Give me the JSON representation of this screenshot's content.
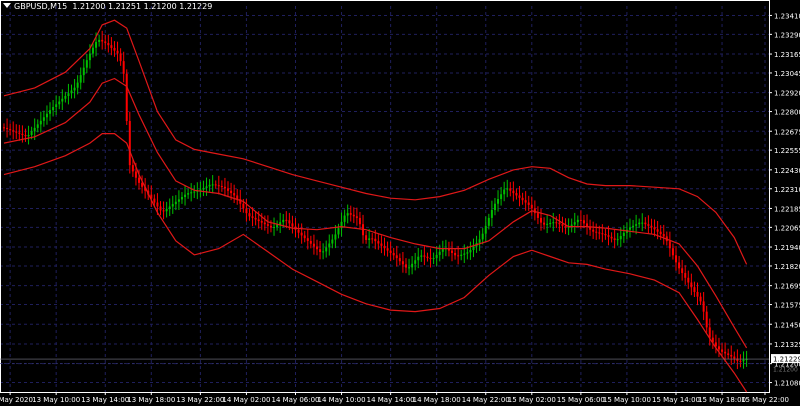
{
  "header": {
    "symbol_label": "GBPUSD,M15",
    "ohlc_label": "1.21200 1.21251 1.21200 1.21229"
  },
  "colors": {
    "background": "#000000",
    "foreground": "#ffffff",
    "grid": "#1f1f5c",
    "bull": "#00c000",
    "bear": "#ff0000",
    "band": "#e01818"
  },
  "chart_data": {
    "type": "line",
    "symbol": "GBPUSD",
    "timeframe": "M15",
    "grid": true,
    "ylim": [
      1.2102,
      1.2347
    ],
    "x_range": [
      0,
      248
    ],
    "x_ticks": [
      {
        "x": 2,
        "label": "13 May 2020"
      },
      {
        "x": 17,
        "label": "13 May 10:00"
      },
      {
        "x": 33,
        "label": "13 May 14:00"
      },
      {
        "x": 48,
        "label": "13 May 18:00"
      },
      {
        "x": 64,
        "label": "13 May 22:00"
      },
      {
        "x": 79,
        "label": "14 May 02:00"
      },
      {
        "x": 95,
        "label": "14 May 06:00"
      },
      {
        "x": 110,
        "label": "14 May 10:00"
      },
      {
        "x": 126,
        "label": "14 May 14:00"
      },
      {
        "x": 141,
        "label": "14 May 18:00"
      },
      {
        "x": 157,
        "label": "14 May 22:00"
      },
      {
        "x": 172,
        "label": "15 May 02:00"
      },
      {
        "x": 188,
        "label": "15 May 06:00"
      },
      {
        "x": 203,
        "label": "15 May 10:00"
      },
      {
        "x": 219,
        "label": "15 May 14:00"
      },
      {
        "x": 234,
        "label": "15 May 18:00"
      },
      {
        "x": 248,
        "label": "15 May 22:00"
      }
    ],
    "y_ticks": [
      "1.23410",
      "1.23290",
      "1.23165",
      "1.23045",
      "1.22920",
      "1.22800",
      "1.22675",
      "1.22555",
      "1.22430",
      "1.22310",
      "1.22185",
      "1.22065",
      "1.21940",
      "1.21820",
      "1.21695",
      "1.21575",
      "1.21450",
      "1.21325",
      "1.21200",
      "1.21080"
    ],
    "current_price": "1.21229",
    "current_price_value": 1.21229,
    "lower_price": "1.21200",
    "lower_price_value": 1.212,
    "series": [
      {
        "role": "price",
        "points": [
          [
            0,
            1.227
          ],
          [
            8,
            1.2264
          ],
          [
            16,
            1.2282
          ],
          [
            24,
            1.2296
          ],
          [
            28,
            1.2315
          ],
          [
            31,
            1.2326
          ],
          [
            34,
            1.2323
          ],
          [
            38,
            1.2316
          ],
          [
            40,
            1.23
          ],
          [
            41,
            1.2248
          ],
          [
            44,
            1.2236
          ],
          [
            48,
            1.2226
          ],
          [
            52,
            1.2216
          ],
          [
            56,
            1.2222
          ],
          [
            60,
            1.2228
          ],
          [
            64,
            1.223
          ],
          [
            68,
            1.2234
          ],
          [
            72,
            1.2232
          ],
          [
            76,
            1.2226
          ],
          [
            80,
            1.2214
          ],
          [
            84,
            1.221
          ],
          [
            88,
            1.2206
          ],
          [
            92,
            1.2212
          ],
          [
            96,
            1.2204
          ],
          [
            100,
            1.2197
          ],
          [
            104,
            1.219
          ],
          [
            108,
            1.22
          ],
          [
            112,
            1.2216
          ],
          [
            116,
            1.2212
          ],
          [
            118,
            1.2198
          ],
          [
            120,
            1.22
          ],
          [
            124,
            1.2194
          ],
          [
            128,
            1.2188
          ],
          [
            132,
            1.218
          ],
          [
            136,
            1.2189
          ],
          [
            140,
            1.2186
          ],
          [
            144,
            1.2194
          ],
          [
            148,
            1.2188
          ],
          [
            152,
            1.2191
          ],
          [
            156,
            1.22
          ],
          [
            160,
            1.222
          ],
          [
            164,
            1.2232
          ],
          [
            168,
            1.2226
          ],
          [
            172,
            1.222
          ],
          [
            176,
            1.2208
          ],
          [
            180,
            1.221
          ],
          [
            184,
            1.2206
          ],
          [
            188,
            1.2212
          ],
          [
            192,
            1.2204
          ],
          [
            196,
            1.2202
          ],
          [
            200,
            1.2198
          ],
          [
            204,
            1.2206
          ],
          [
            208,
            1.221
          ],
          [
            212,
            1.2206
          ],
          [
            216,
            1.22
          ],
          [
            220,
            1.2182
          ],
          [
            224,
            1.217
          ],
          [
            228,
            1.2158
          ],
          [
            230,
            1.2138
          ],
          [
            232,
            1.2132
          ],
          [
            234,
            1.2128
          ],
          [
            236,
            1.2126
          ],
          [
            238,
            1.2124
          ],
          [
            240,
            1.2121
          ],
          [
            242,
            1.2123
          ]
        ]
      },
      {
        "role": "upper-band",
        "points": [
          [
            0,
            1.229
          ],
          [
            10,
            1.2295
          ],
          [
            20,
            1.2305
          ],
          [
            28,
            1.232
          ],
          [
            32,
            1.2335
          ],
          [
            36,
            1.2338
          ],
          [
            40,
            1.2333
          ],
          [
            44,
            1.2312
          ],
          [
            50,
            1.228
          ],
          [
            56,
            1.2262
          ],
          [
            62,
            1.2256
          ],
          [
            70,
            1.2253
          ],
          [
            78,
            1.225
          ],
          [
            86,
            1.2245
          ],
          [
            94,
            1.224
          ],
          [
            102,
            1.2236
          ],
          [
            110,
            1.2232
          ],
          [
            118,
            1.2228
          ],
          [
            126,
            1.2225
          ],
          [
            134,
            1.2224
          ],
          [
            142,
            1.2226
          ],
          [
            150,
            1.223
          ],
          [
            158,
            1.2237
          ],
          [
            166,
            1.2243
          ],
          [
            172,
            1.2245
          ],
          [
            178,
            1.2244
          ],
          [
            184,
            1.2238
          ],
          [
            190,
            1.2234
          ],
          [
            196,
            1.2233
          ],
          [
            204,
            1.2233
          ],
          [
            212,
            1.2232
          ],
          [
            220,
            1.2231
          ],
          [
            226,
            1.2226
          ],
          [
            232,
            1.2216
          ],
          [
            238,
            1.22
          ],
          [
            242,
            1.2183
          ]
        ]
      },
      {
        "role": "middle-band",
        "points": [
          [
            0,
            1.226
          ],
          [
            10,
            1.2264
          ],
          [
            20,
            1.2273
          ],
          [
            28,
            1.2286
          ],
          [
            32,
            1.2298
          ],
          [
            36,
            1.2301
          ],
          [
            40,
            1.2296
          ],
          [
            44,
            1.2278
          ],
          [
            50,
            1.2254
          ],
          [
            56,
            1.2236
          ],
          [
            62,
            1.223
          ],
          [
            70,
            1.2228
          ],
          [
            78,
            1.2223
          ],
          [
            86,
            1.221
          ],
          [
            94,
            1.2206
          ],
          [
            102,
            1.2205
          ],
          [
            110,
            1.2207
          ],
          [
            118,
            1.2205
          ],
          [
            126,
            1.22
          ],
          [
            134,
            1.2196
          ],
          [
            142,
            1.2193
          ],
          [
            150,
            1.2193
          ],
          [
            158,
            1.2198
          ],
          [
            166,
            1.221
          ],
          [
            172,
            1.2217
          ],
          [
            178,
            1.2214
          ],
          [
            184,
            1.2207
          ],
          [
            190,
            1.2207
          ],
          [
            196,
            1.2206
          ],
          [
            204,
            1.2204
          ],
          [
            212,
            1.2202
          ],
          [
            220,
            1.2196
          ],
          [
            226,
            1.2182
          ],
          [
            232,
            1.2163
          ],
          [
            238,
            1.2143
          ],
          [
            242,
            1.213
          ]
        ]
      },
      {
        "role": "lower-band",
        "points": [
          [
            0,
            1.224
          ],
          [
            10,
            1.2245
          ],
          [
            20,
            1.2252
          ],
          [
            28,
            1.226
          ],
          [
            32,
            1.2266
          ],
          [
            36,
            1.2266
          ],
          [
            40,
            1.226
          ],
          [
            44,
            1.224
          ],
          [
            50,
            1.2216
          ],
          [
            56,
            1.2198
          ],
          [
            62,
            1.2189
          ],
          [
            70,
            1.2193
          ],
          [
            78,
            1.2202
          ],
          [
            86,
            1.2191
          ],
          [
            94,
            1.218
          ],
          [
            102,
            1.2172
          ],
          [
            110,
            1.2164
          ],
          [
            118,
            1.2158
          ],
          [
            126,
            1.2154
          ],
          [
            134,
            1.2153
          ],
          [
            142,
            1.2155
          ],
          [
            150,
            1.2162
          ],
          [
            158,
            1.2176
          ],
          [
            166,
            1.2188
          ],
          [
            172,
            1.2192
          ],
          [
            178,
            1.2188
          ],
          [
            184,
            1.2184
          ],
          [
            190,
            1.2183
          ],
          [
            196,
            1.218
          ],
          [
            204,
            1.2177
          ],
          [
            212,
            1.2173
          ],
          [
            220,
            1.2165
          ],
          [
            226,
            1.2148
          ],
          [
            232,
            1.213
          ],
          [
            238,
            1.2114
          ],
          [
            242,
            1.2102
          ]
        ]
      }
    ]
  }
}
